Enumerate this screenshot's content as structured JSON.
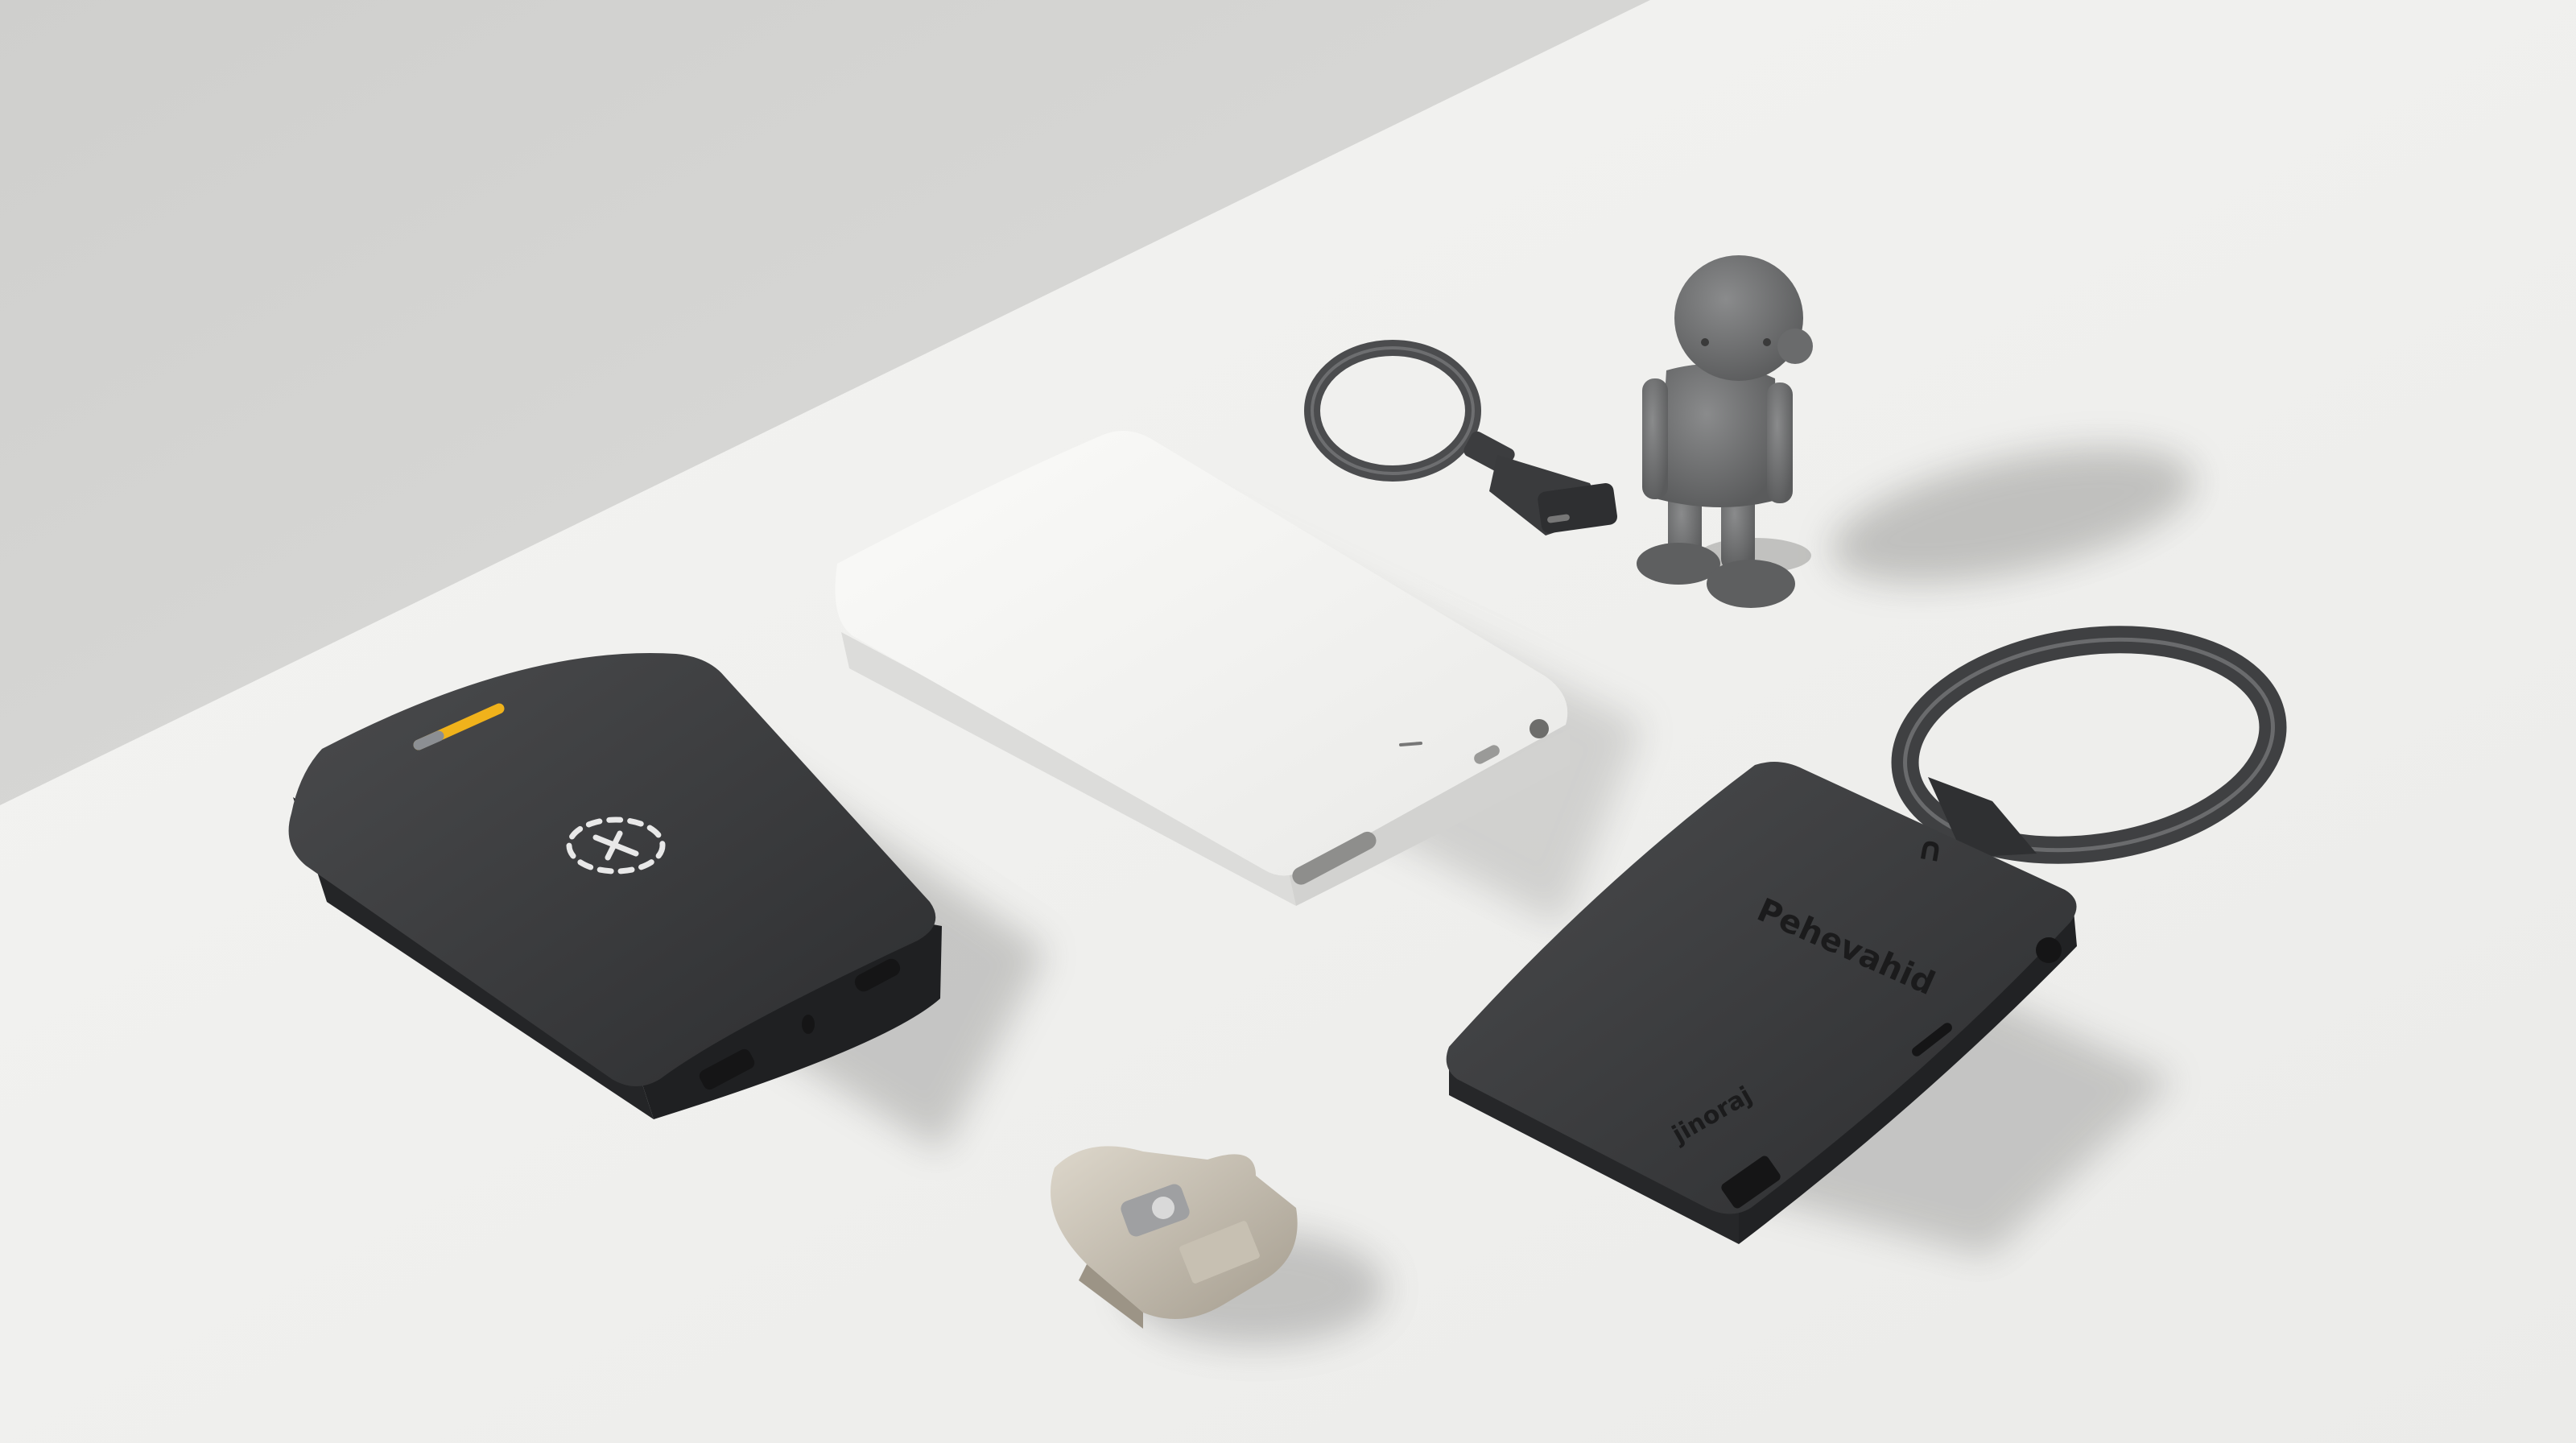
{
  "image": {
    "kind": "product-photo",
    "objects": [
      "black-power-bank",
      "white-power-bank",
      "small-keyring-with-clip",
      "gray-robot-figurine",
      "black-card-tracker-with-keyring",
      "metal-key-fob"
    ]
  },
  "printed_text": {
    "tracker_top_text": "Pehevahid",
    "tracker_side_text": "jinoraj",
    "tracker_symbol": "∩"
  },
  "colors": {
    "background_wall": "#d9d9d7",
    "table_surface": "#f1f1ef",
    "black_device": "#3a3b3d",
    "white_device": "#f7f7f5",
    "indicator": "#f0b21b",
    "figurine": "#6c6d6e",
    "metal": "#c9c2b4",
    "ring": "#4b4c4e"
  }
}
